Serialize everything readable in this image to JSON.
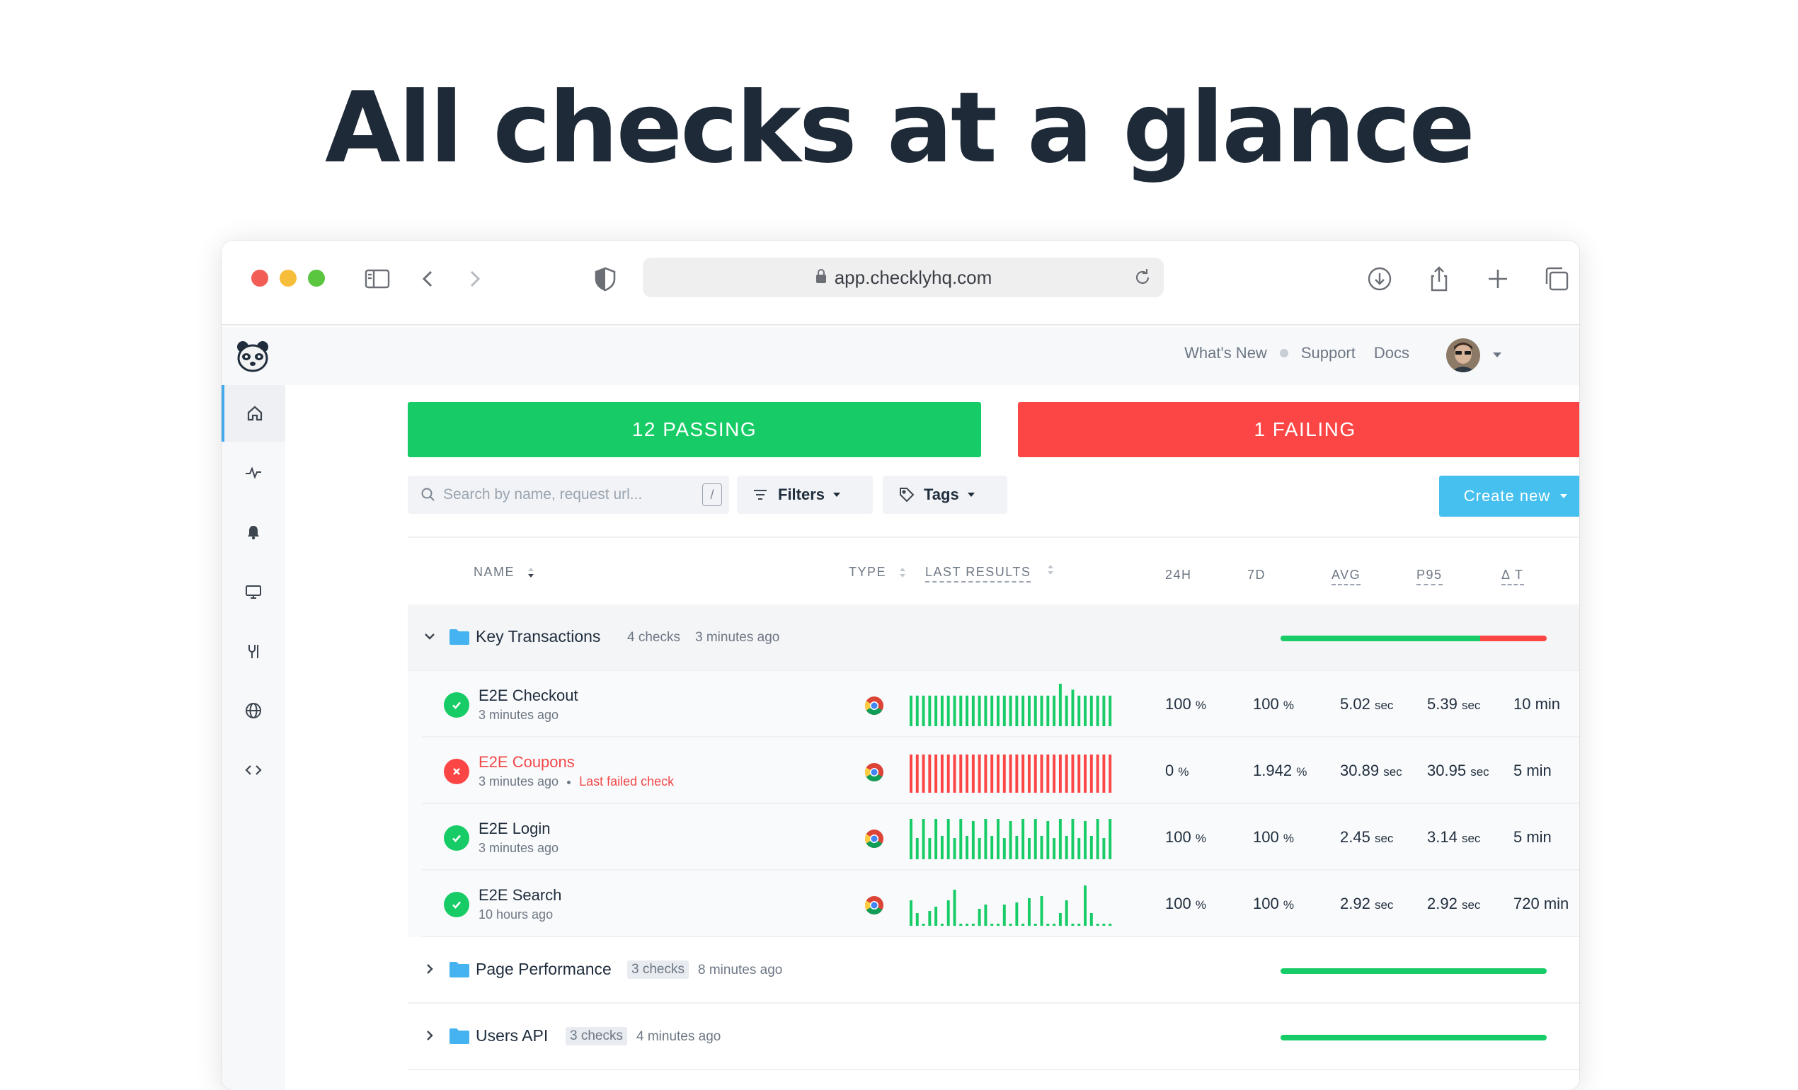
{
  "hero": {
    "title": "All checks  at a glance"
  },
  "browser": {
    "url": "app.checklyhq.com"
  },
  "header": {
    "nav": [
      "What's New",
      "Support",
      "Docs"
    ]
  },
  "sidebar": {
    "items": [
      {
        "icon": "home-icon",
        "active": true
      },
      {
        "icon": "activity-icon",
        "active": false
      },
      {
        "icon": "bell-icon",
        "active": false
      },
      {
        "icon": "monitor-icon",
        "active": false
      },
      {
        "icon": "tools-icon",
        "active": false
      },
      {
        "icon": "globe-icon",
        "active": false
      },
      {
        "icon": "code-icon",
        "active": false
      }
    ]
  },
  "summary": {
    "passing": "12 PASSING",
    "failing": "1 FAILING",
    "passing_color": "#17cc66",
    "failing_color": "#fc4646"
  },
  "toolbar": {
    "search_placeholder": "Search by name, request url...",
    "search_shortcut": "/",
    "filters_label": "Filters",
    "tags_label": "Tags",
    "create_label": "Create new"
  },
  "table": {
    "columns": {
      "name": "NAME",
      "type": "TYPE",
      "last_results": "LAST RESULTS",
      "h24": "24H",
      "d7": "7D",
      "avg": "AVG",
      "p95": "P95",
      "dt": "Δ T"
    },
    "groups": [
      {
        "name": "Key Transactions",
        "count": "4 checks",
        "time": "3 minutes ago",
        "expanded": true,
        "pass_fraction": 0.75,
        "checks": [
          {
            "name": "E2E Checkout",
            "time": "3 minutes ago",
            "status": "passing",
            "note": "",
            "h24": "100",
            "d7": "100",
            "avg": "5.02",
            "p95": "5.39",
            "dt": "10 min",
            "results": [
              0.72,
              0.72,
              0.72,
              0.72,
              0.72,
              0.72,
              0.72,
              0.72,
              0.72,
              0.72,
              0.72,
              0.72,
              0.72,
              0.72,
              0.72,
              0.72,
              0.72,
              0.72,
              0.72,
              0.72,
              0.72,
              0.72,
              0.72,
              0.72,
              1.0,
              0.72,
              0.86,
              0.72,
              0.72,
              0.72,
              0.72,
              0.72,
              0.72
            ]
          },
          {
            "name": "E2E Coupons",
            "time": "3 minutes ago",
            "status": "failing",
            "note": "Last failed check",
            "h24": "0",
            "d7": "1.942",
            "avg": "30.89",
            "p95": "30.95",
            "dt": "5 min",
            "results": [
              0.9,
              0.9,
              0.9,
              0.9,
              0.9,
              0.9,
              0.9,
              0.9,
              0.9,
              0.9,
              0.9,
              0.9,
              0.9,
              0.9,
              0.9,
              0.9,
              0.9,
              0.9,
              0.9,
              0.9,
              0.9,
              0.9,
              0.9,
              0.9,
              0.9,
              0.9,
              0.9,
              0.9,
              0.9,
              0.9,
              0.9,
              0.9,
              0.9
            ]
          },
          {
            "name": "E2E Login",
            "time": "3 minutes ago",
            "status": "passing",
            "note": "",
            "h24": "100",
            "d7": "100",
            "avg": "2.45",
            "p95": "3.14",
            "dt": "5 min",
            "results": [
              0.95,
              0.5,
              0.95,
              0.5,
              0.95,
              0.55,
              0.95,
              0.5,
              0.95,
              0.55,
              0.9,
              0.5,
              0.95,
              0.55,
              0.95,
              0.5,
              0.9,
              0.55,
              0.95,
              0.5,
              0.95,
              0.55,
              0.9,
              0.5,
              0.95,
              0.55,
              0.95,
              0.5,
              0.9,
              0.55,
              0.95,
              0.5,
              0.95
            ]
          },
          {
            "name": "E2E Search",
            "time": "10 hours ago",
            "status": "passing",
            "note": "",
            "h24": "100",
            "d7": "100",
            "avg": "2.92",
            "p95": "2.92",
            "dt": "720 min",
            "results": [
              0.6,
              0.3,
              0.05,
              0.35,
              0.45,
              0.05,
              0.6,
              0.85,
              0.05,
              0.05,
              0.05,
              0.4,
              0.5,
              0.05,
              0.05,
              0.5,
              0.05,
              0.55,
              0.05,
              0.65,
              0.05,
              0.7,
              0.05,
              0.05,
              0.3,
              0.6,
              0.05,
              0.05,
              0.95,
              0.3,
              0.05,
              0.05,
              0.05
            ]
          }
        ]
      },
      {
        "name": "Page Performance",
        "count": "3 checks",
        "time": "8 minutes ago",
        "expanded": false,
        "pass_fraction": 1.0
      },
      {
        "name": "Users API",
        "count": "3 checks",
        "time": "4 minutes ago",
        "expanded": false,
        "pass_fraction": 1.0
      }
    ],
    "units": {
      "percent": "%",
      "sec": "sec"
    }
  },
  "colors": {
    "pass": "#17cc66",
    "fail": "#fc4646",
    "accent": "#45c0ef",
    "folder": "#45b3f0"
  }
}
